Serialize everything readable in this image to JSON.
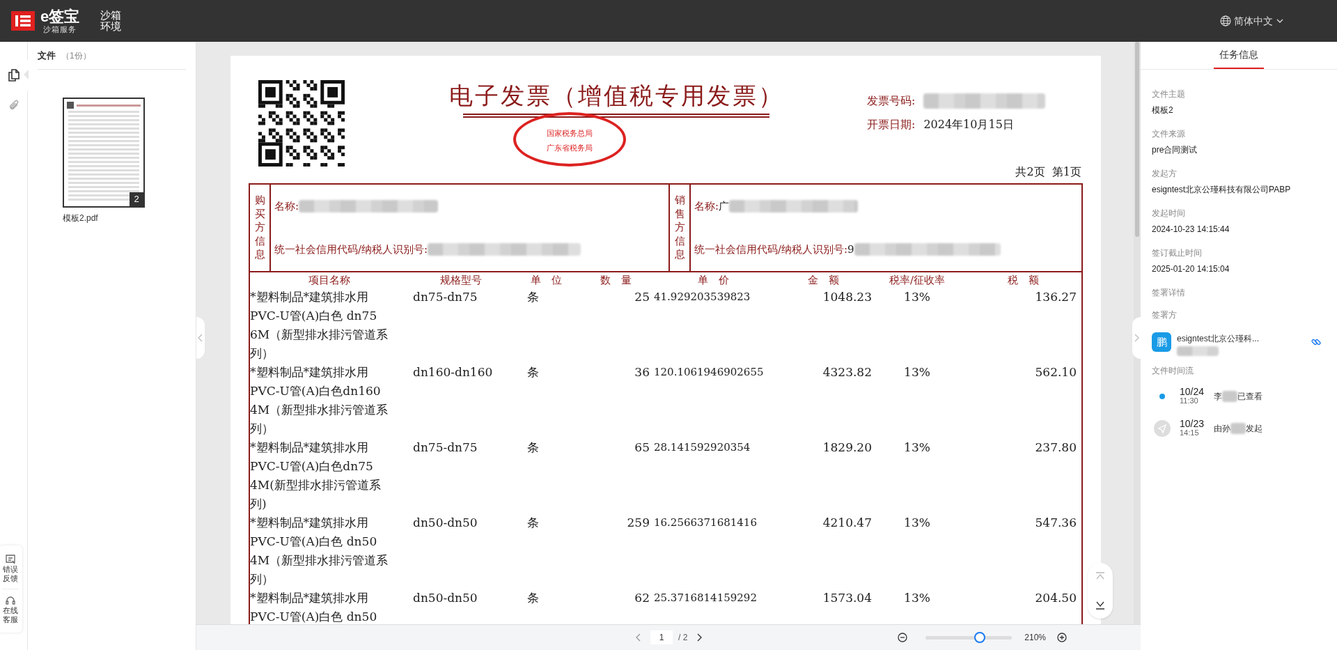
{
  "header": {
    "brand": "e签宝",
    "brand_sub": "沙箱服务",
    "environment": "沙箱环境",
    "language": "简体中文"
  },
  "rail": {
    "items": [
      {
        "kind": "files",
        "selected": true
      },
      {
        "kind": "attachments",
        "selected": false
      }
    ],
    "help": [
      "错误反馈",
      "在线客服"
    ]
  },
  "files_panel": {
    "title": "文件",
    "count": "（1份）",
    "files": [
      {
        "name": "模板2.pdf",
        "pages": "2"
      }
    ]
  },
  "invoice": {
    "title": "电子发票（增值税专用发票）",
    "stamp": [
      "国家税务总局",
      "广东省税务局"
    ],
    "number_label": "发票号码:",
    "date_label": "开票日期:",
    "date": "2024年10月15日",
    "page_info": "共2页  第1页",
    "buyer": {
      "label": "购买方信息",
      "name_label": "名称:",
      "id_label": "统一社会信用代码/纳税人识别号:"
    },
    "seller": {
      "label": "销售方信息",
      "name_label": "名称:",
      "name_prefix": "广",
      "id_label": "统一社会信用代码/纳税人识别号:",
      "id_prefix": "9"
    },
    "columns": [
      "项目名称",
      "规格型号",
      "单　位",
      "数　量",
      "单　价",
      "金　额",
      "税率/征收率",
      "税　额"
    ],
    "rows": [
      {
        "name": [
          "*塑料制品*建筑排水用",
          "PVC-U管(A)白色 dn75",
          "6M（新型排水排污管道系",
          "列）"
        ],
        "spec": "dn75-dn75",
        "unit": "条",
        "qty": "25",
        "price": "41.929203539823",
        "amount": "1048.23",
        "rate": "13%",
        "tax": "136.27"
      },
      {
        "name": [
          "*塑料制品*建筑排水用",
          "PVC-U管(A)白色dn160",
          "4M（新型排水排污管道系",
          "列）"
        ],
        "spec": "dn160-dn160",
        "unit": "条",
        "qty": "36",
        "price": "120.1061946902655",
        "amount": "4323.82",
        "rate": "13%",
        "tax": "562.10"
      },
      {
        "name": [
          "*塑料制品*建筑排水用",
          "PVC-U管(A)白色dn75",
          "4M(新型排水排污管道系",
          "列)"
        ],
        "spec": "dn75-dn75",
        "unit": "条",
        "qty": "65",
        "price": "28.141592920354",
        "amount": "1829.20",
        "rate": "13%",
        "tax": "237.80"
      },
      {
        "name": [
          "*塑料制品*建筑排水用",
          "PVC-U管(A)白色 dn50",
          "4M（新型排水排污管道系",
          "列）"
        ],
        "spec": "dn50-dn50",
        "unit": "条",
        "qty": "259",
        "price": "16.2566371681416",
        "amount": "4210.47",
        "rate": "13%",
        "tax": "547.36"
      },
      {
        "name": [
          "*塑料制品*建筑排水用",
          "PVC-U管(A)白色 dn50"
        ],
        "spec": "dn50-dn50",
        "unit": "条",
        "qty": "62",
        "price": "25.3716814159292",
        "amount": "1573.04",
        "rate": "13%",
        "tax": "204.50"
      }
    ]
  },
  "viewer_toolbar": {
    "page": "1",
    "total": "/ 2",
    "zoom": {
      "level": 0.63
    },
    "zoom_reading": "210%"
  },
  "task_panel": {
    "tab": "任务信息",
    "fields": [
      {
        "label": "文件主题",
        "value": "模板2"
      },
      {
        "label": "文件来源",
        "value": "pre合同测试"
      },
      {
        "label": "发起方",
        "value": "esigntest北京公瑾科技有限公司PABP"
      },
      {
        "label": "发起时间",
        "value": "2024-10-23 14:15:44"
      },
      {
        "label": "签订截止时间",
        "value": "2025-01-20 14:15:04"
      }
    ],
    "sign_details": "签署详情",
    "signers_label": "签署方",
    "signers": [
      {
        "avatar": "鹏",
        "name": "esigntest北京公瑾科..."
      }
    ],
    "timeline_label": "文件时间流",
    "timeline": [
      {
        "kind": "viewed",
        "date": "10/24",
        "time": "11:30",
        "before": "李",
        "after": "已查看"
      },
      {
        "kind": "sent",
        "date": "10/23",
        "time": "14:15",
        "before": "由孙",
        "after": "发起"
      }
    ]
  }
}
